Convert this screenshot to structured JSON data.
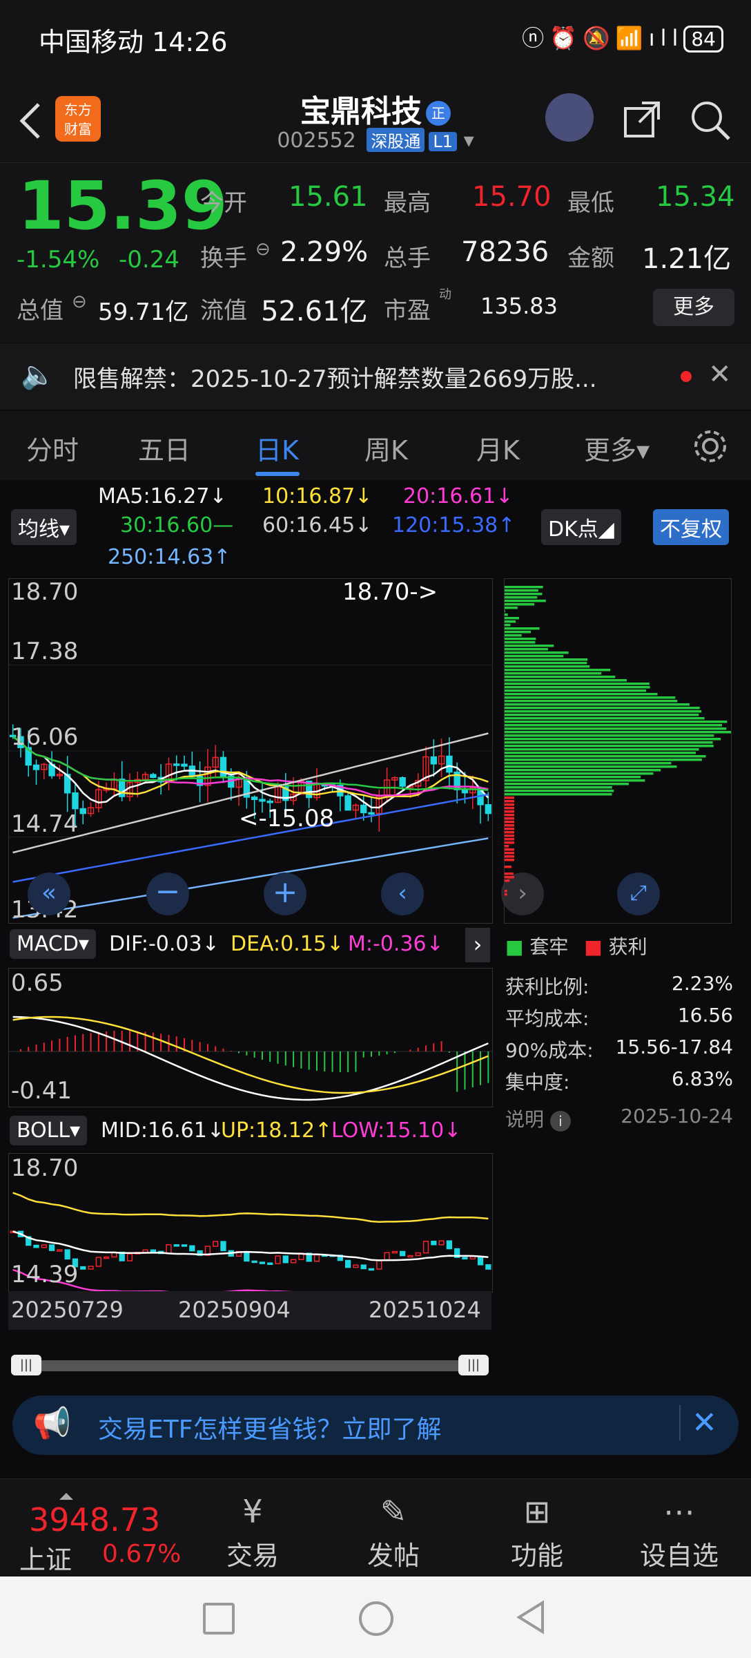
{
  "status": {
    "carrier_time": "中国移动 14:26",
    "battery": "84"
  },
  "header": {
    "stock_name": "宝鼎科技",
    "zheng_badge": "正",
    "code": "002552",
    "tag1": "深股通",
    "tag2": "L1",
    "logo_line1": "东方",
    "logo_line2": "财富"
  },
  "quote": {
    "price": "15.39",
    "change_pct": "-1.54%",
    "change_amt": "-0.24",
    "open_label": "今开",
    "open": "15.61",
    "high_label": "最高",
    "high": "15.70",
    "low_label": "最低",
    "low": "15.34",
    "turnover_label": "换手",
    "turnover": "2.29%",
    "volume_label": "总手",
    "volume": "78236",
    "amount_label": "金额",
    "amount": "1.21亿",
    "total_value_label": "总值",
    "total_value": "59.71亿",
    "float_value_label": "流值",
    "float_value": "52.61亿",
    "pe_label": "市盈",
    "pe_sup": "动",
    "pe": "135.83",
    "more_label": "更多"
  },
  "notice": {
    "text": "限售解禁：2025-10-27预计解禁数量2669万股..."
  },
  "tabs": [
    "分时",
    "五日",
    "日K",
    "周K",
    "月K",
    "更多▾"
  ],
  "active_tab": 2,
  "ma": {
    "btn": "均线▾",
    "ma5": "MA5:16.27↓",
    "ma10": "10:16.87↓",
    "ma20": "20:16.61↓",
    "ma30": "30:16.60—",
    "ma60": "60:16.45↓",
    "ma120": "120:15.38↑",
    "ma250": "250:14.63↑",
    "dk_btn": "DK点◢",
    "fq_btn": "不复权"
  },
  "kline": {
    "axis": [
      "18.70",
      "17.38",
      "16.06",
      "14.74",
      "13.42"
    ],
    "high_note": "18.70->",
    "low_note": "<-15.08"
  },
  "macd": {
    "btn": "MACD▾",
    "dif": "DIF:-0.03↓",
    "dea": "DEA:0.15↓",
    "m": "M:-0.36↓",
    "axis_top": "0.65",
    "axis_bottom": "-0.41"
  },
  "boll": {
    "btn": "BOLL▾",
    "mid": "MID:16.61↓",
    "up": "UP:18.12↑",
    "low": "LOW:15.10↓",
    "axis_top": "18.70",
    "axis_bottom": "14.39"
  },
  "dates": [
    "20250729",
    "20250904",
    "20251024"
  ],
  "chip": {
    "legend1": "套牢",
    "legend2": "获利",
    "rows": [
      {
        "label": "获利比例:",
        "value": "2.23%"
      },
      {
        "label": "平均成本:",
        "value": "16.56"
      },
      {
        "label": "90%成本:",
        "value": "15.56-17.84"
      },
      {
        "label": "集中度:",
        "value": "6.83%"
      }
    ],
    "note_label": "说明",
    "note_date": "2025-10-24"
  },
  "banner": {
    "text": "交易ETF怎样更省钱？立即了解"
  },
  "bottom": {
    "index_value": "3948.73",
    "index_name": "上证",
    "index_pct": "0.67%",
    "items": [
      "交易",
      "发帖",
      "功能",
      "设自选"
    ]
  },
  "chart_data": {
    "type": "candlestick",
    "title": "宝鼎科技 日K",
    "price_axis": [
      13.42,
      14.74,
      16.06,
      17.38,
      18.7
    ],
    "period_high": 18.7,
    "period_low": 15.08,
    "x_ticks": [
      "20250729",
      "20250904",
      "20251024"
    ],
    "last_close": 15.39
  }
}
